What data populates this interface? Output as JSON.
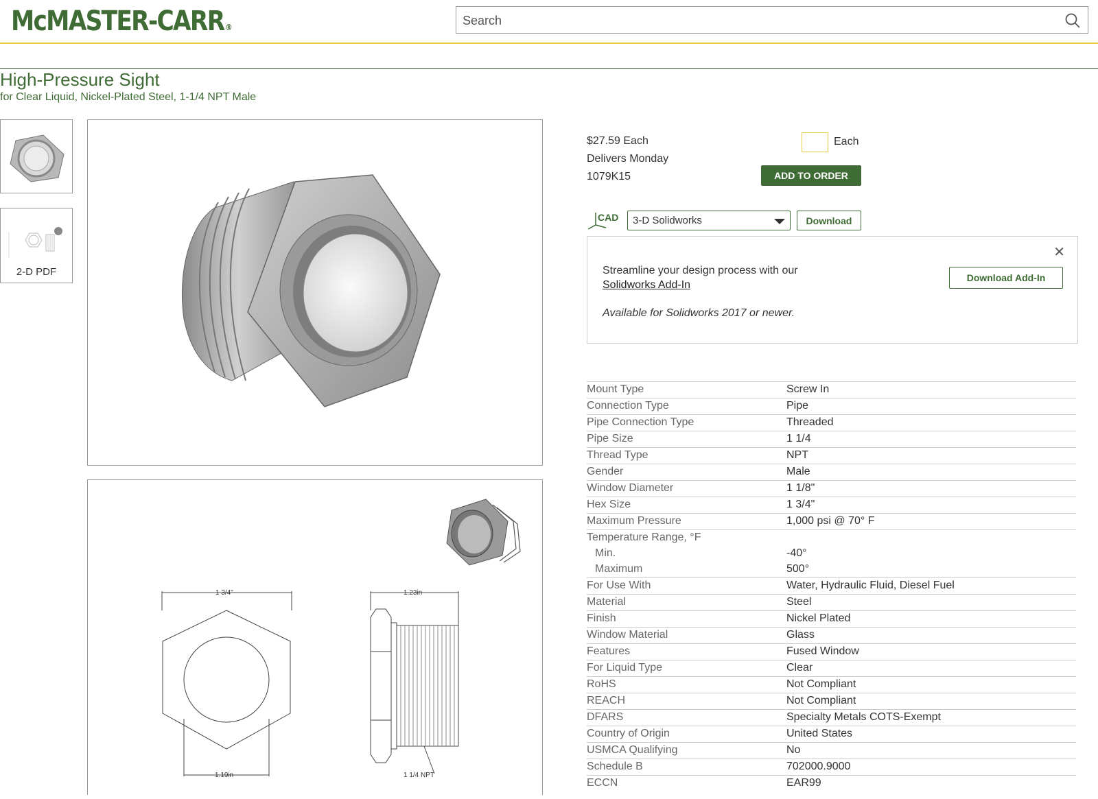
{
  "header": {
    "logo": "McMASTER-CARR",
    "logo_reg": "®",
    "search_placeholder": "Search"
  },
  "product": {
    "title": "High-Pressure Sight",
    "subtitle": "for Clear Liquid, Nickel-Plated Steel, 1-1/4 NPT Male",
    "price": "$27.59 Each",
    "delivery": "Delivers Monday",
    "part_number": "1079K15",
    "qty_unit": "Each",
    "add_label": "ADD TO ORDER"
  },
  "thumbnails": {
    "pdf_label": "2-D PDF"
  },
  "drawing": {
    "dim_hex": "1 3/4\"",
    "dim_len": "1.23in",
    "dim_window": "1.19in",
    "dim_thread": "1 1/4 NPT"
  },
  "cad": {
    "icon_label": "CAD",
    "format": "3-D Solidworks",
    "download_label": "Download"
  },
  "promo": {
    "line1": "Streamline your design process with our",
    "link": "Solidworks Add-In",
    "note": "Available for Solidworks 2017 or newer.",
    "button": "Download Add-In",
    "close": "✕"
  },
  "specs": [
    {
      "k": "Mount Type",
      "v": "Screw In"
    },
    {
      "k": "Connection Type",
      "v": "Pipe"
    },
    {
      "k": "Pipe Connection Type",
      "v": "Threaded"
    },
    {
      "k": "Pipe Size",
      "v": "1 1/4"
    },
    {
      "k": "Thread Type",
      "v": "NPT"
    },
    {
      "k": "Gender",
      "v": "Male"
    },
    {
      "k": "Window Diameter",
      "v": "1 1/8\""
    },
    {
      "k": "Hex Size",
      "v": "1 3/4\""
    },
    {
      "k": "Maximum Pressure",
      "v": "1,000 psi @ 70° F"
    },
    {
      "k": "Temperature Range, °F",
      "v": ""
    },
    {
      "k": "Min.",
      "v": "-40°",
      "sub": true
    },
    {
      "k": "Maximum",
      "v": "500°",
      "sub": true
    },
    {
      "k": "For Use With",
      "v": "Water, Hydraulic Fluid, Diesel Fuel"
    },
    {
      "k": "Material",
      "v": "Steel"
    },
    {
      "k": "Finish",
      "v": "Nickel Plated"
    },
    {
      "k": "Window Material",
      "v": "Glass"
    },
    {
      "k": "Features",
      "v": "Fused Window"
    },
    {
      "k": "For Liquid Type",
      "v": "Clear"
    },
    {
      "k": "RoHS",
      "v": "Not Compliant"
    },
    {
      "k": "REACH",
      "v": "Not Compliant"
    },
    {
      "k": "DFARS",
      "v": "Specialty Metals COTS-Exempt"
    },
    {
      "k": "Country of Origin",
      "v": "United States"
    },
    {
      "k": "USMCA Qualifying",
      "v": "No"
    },
    {
      "k": "Schedule B",
      "v": "702000.9000"
    },
    {
      "k": "ECCN",
      "v": "EAR99"
    }
  ],
  "colors": {
    "brand_green": "#3f6b34",
    "accent_yellow": "#e6cf3a"
  }
}
